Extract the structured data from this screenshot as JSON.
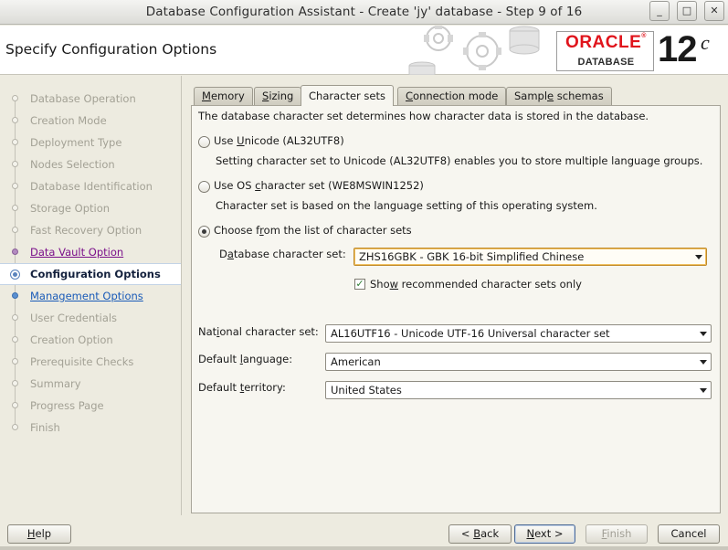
{
  "window": {
    "title": "Database Configuration Assistant - Create 'jy' database - Step 9 of 16",
    "minimize_label": "_",
    "maximize_label": "□",
    "close_label": "✕"
  },
  "header": {
    "page_title": "Specify Configuration Options",
    "logo_oracle": "ORACLE",
    "logo_reg": "®",
    "logo_database": "DATABASE",
    "version": "12",
    "version_suffix": "c"
  },
  "nav": {
    "items": [
      {
        "label": "Database Operation",
        "state": "disabled"
      },
      {
        "label": "Creation Mode",
        "state": "disabled"
      },
      {
        "label": "Deployment Type",
        "state": "disabled"
      },
      {
        "label": "Nodes Selection",
        "state": "disabled"
      },
      {
        "label": "Database Identification",
        "state": "disabled"
      },
      {
        "label": "Storage Option",
        "state": "disabled"
      },
      {
        "label": "Fast Recovery Option",
        "state": "disabled"
      },
      {
        "label": "Data Vault Option",
        "state": "visited"
      },
      {
        "label": "Configuration Options",
        "state": "current"
      },
      {
        "label": "Management Options",
        "state": "link"
      },
      {
        "label": "User Credentials",
        "state": "disabled"
      },
      {
        "label": "Creation Option",
        "state": "disabled"
      },
      {
        "label": "Prerequisite Checks",
        "state": "disabled"
      },
      {
        "label": "Summary",
        "state": "disabled"
      },
      {
        "label": "Progress Page",
        "state": "disabled"
      },
      {
        "label": "Finish",
        "state": "disabled"
      }
    ]
  },
  "tabs": {
    "memory": {
      "m": "M",
      "rest": "emory"
    },
    "sizing": {
      "s": "S",
      "rest": "izing"
    },
    "charsets": {
      "label": "Character sets"
    },
    "connection": {
      "c": "C",
      "rest": "onnection mode"
    },
    "sample": {
      "pre": "Sampl",
      "e": "e",
      "rest": " schemas"
    }
  },
  "charset": {
    "intro": "The database character set determines how character data is stored in the database.",
    "unicode_pre": "Use ",
    "unicode_u": "U",
    "unicode_rest": "nicode (AL32UTF8)",
    "unicode_desc": "Setting character set to Unicode (AL32UTF8) enables you to store multiple language groups.",
    "os_pre": "Use OS ",
    "os_c": "c",
    "os_rest": "haracter set (WE8MSWIN1252)",
    "os_desc": "Character set is based on the language setting of this operating system.",
    "list_pre": "Choose f",
    "list_r": "r",
    "list_rest": "om the list of character sets",
    "db_charset_label_pre": "D",
    "db_charset_label_a": "a",
    "db_charset_label_rest": "tabase character set:",
    "db_charset_value": "ZHS16GBK - GBK 16-bit Simplified Chinese",
    "show_rec_pre": "Sho",
    "show_rec_w": "w",
    "show_rec_rest": " recommended character sets only",
    "show_rec_check": "✓",
    "national_pre": "Nat",
    "national_i": "i",
    "national_rest": "onal character set:",
    "national_value": "AL16UTF16 - Unicode UTF-16 Universal character set",
    "lang_pre": "Default ",
    "lang_l": "l",
    "lang_rest": "anguage:",
    "lang_value": "American",
    "terr_pre": "Default ",
    "terr_t": "t",
    "terr_rest": "erritory:",
    "terr_value": "United States"
  },
  "buttons": {
    "help_h": "H",
    "help_rest": "elp",
    "back_pre": "< ",
    "back_b": "B",
    "back_rest": "ack",
    "next_n": "N",
    "next_rest": "ext >",
    "finish_f": "F",
    "finish_rest": "inish",
    "cancel": "Cancel"
  }
}
